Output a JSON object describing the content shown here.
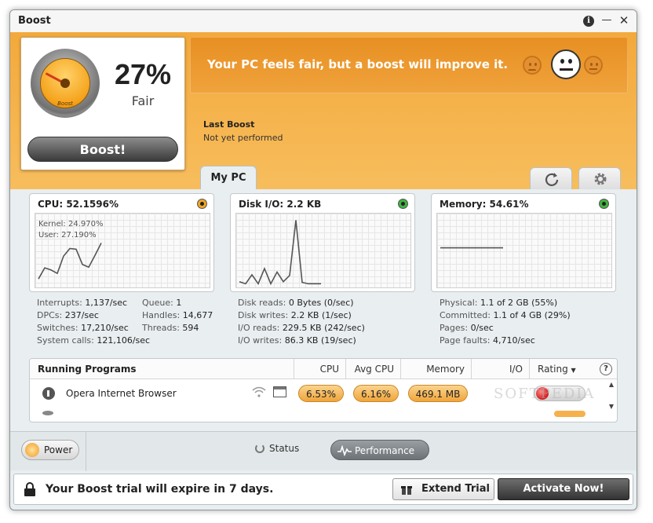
{
  "window": {
    "title": "Boost"
  },
  "titlebar": {
    "info_glyph": "i",
    "minimize_glyph": "—",
    "close_glyph": "✕"
  },
  "score": {
    "percent_label": "27%",
    "percent_value": 27,
    "status": "Fair",
    "gauge_text": "Boost",
    "boost_button": "Boost!"
  },
  "banner": {
    "message": "Your PC feels fair, but a boost will improve it.",
    "mood_selected": "neutral",
    "mood_icons": [
      "sad-face-icon",
      "neutral-face-icon",
      "happy-face-icon"
    ]
  },
  "last_boost": {
    "title": "Last Boost",
    "value": "Not yet performed"
  },
  "tabs": {
    "mypc": "My PC",
    "refresh_icon": "refresh-icon",
    "settings_icon": "gear-icon"
  },
  "cpu": {
    "title": "CPU: 52.1596%",
    "kernel": "Kernel:  24.970%",
    "user": "User:  27.190%",
    "history": [
      10,
      26,
      23,
      18,
      43,
      54,
      53,
      31,
      27,
      44,
      62
    ]
  },
  "disk": {
    "title": "Disk I/O: 2.2 KB",
    "history": [
      6,
      3,
      16,
      3,
      25,
      3,
      20,
      6,
      15,
      95,
      5,
      3,
      3,
      3
    ]
  },
  "memory": {
    "title": "Memory: 54.61%",
    "history": [
      55,
      55,
      55,
      55,
      55,
      55,
      55,
      55,
      55,
      55,
      55
    ]
  },
  "cpu_stats": {
    "interrupts_label": "Interrupts:",
    "interrupts": "1,137/sec",
    "dpcs_label": "DPCs:",
    "dpcs": "237/sec",
    "switches_label": "Switches:",
    "switches": "17,210/sec",
    "syscalls_label": "System calls:",
    "syscalls": "121,106/sec",
    "queue_label": "Queue:",
    "queue": "1",
    "handles_label": "Handles:",
    "handles": "14,677",
    "threads_label": "Threads:",
    "threads": "594"
  },
  "disk_stats": {
    "reads_label": "Disk reads:",
    "reads": "0 Bytes (0/sec)",
    "writes_label": "Disk writes:",
    "writes": "2.2 KB (1/sec)",
    "io_reads_label": "I/O reads:",
    "io_reads": "229.5 KB (242/sec)",
    "io_writes_label": "I/O writes:",
    "io_writes": "86.3 KB (19/sec)"
  },
  "mem_stats": {
    "physical_label": "Physical:",
    "physical": "1.1 of 2 GB (55%)",
    "committed_label": "Committed:",
    "committed": "1.1 of 4 GB (29%)",
    "pages_label": "Pages:",
    "pages": "0/sec",
    "faults_label": "Page faults:",
    "faults": "4,710/sec"
  },
  "programs": {
    "title": "Running Programs",
    "col_cpu": "CPU",
    "col_avg_cpu": "Avg CPU",
    "col_memory": "Memory",
    "col_io": "I/O",
    "col_rating": "Rating",
    "help_glyph": "?",
    "rows": [
      {
        "name": "Opera Internet Browser",
        "cpu": "6.53%",
        "avg_cpu": "6.16%",
        "memory": "469.1 MB",
        "rating_status": "red"
      }
    ]
  },
  "watermark": "SOFTPEDIA",
  "footer": {
    "power": "Power",
    "status": "Status",
    "performance": "Performance"
  },
  "trial": {
    "message": "Your Boost trial will expire in 7 days.",
    "extend": "Extend Trial",
    "activate": "Activate Now!"
  },
  "colors": {
    "accent": "#f3a93b",
    "banner": "#e78f22",
    "panel_bg": "#e9eef0",
    "rating_bad": "#d21c1c"
  }
}
